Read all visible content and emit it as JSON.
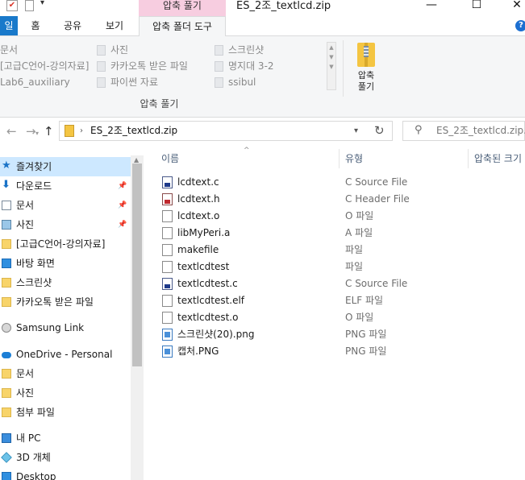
{
  "titlebar": {
    "context_header": "압축 풀기",
    "title": "ES_2조_textlcd.zip",
    "min_glyph": "—",
    "max_glyph": "☐",
    "close_glyph": "✕"
  },
  "tabs": [
    {
      "label": "일"
    },
    {
      "label": "홈"
    },
    {
      "label": "공유"
    },
    {
      "label": "보기"
    },
    {
      "label": "압축 폴더 도구"
    }
  ],
  "help": "?",
  "ribbon": {
    "destinations": [
      [
        "문서",
        "사진",
        "스크린샷"
      ],
      [
        "[고급C언어-강의자료]",
        "카카오톡 받은 파일",
        "명지대 3-2"
      ],
      [
        "Lab6_auxiliary",
        "파이썬 자료",
        "ssibul"
      ]
    ],
    "extract_all_label_1": "압축",
    "extract_all_label_2": "풀기",
    "group_label": "압축 풀기"
  },
  "address": {
    "path": "ES_2조_textlcd.zip",
    "search_placeholder": "ES_2조_textlcd.zip..."
  },
  "sidebar": {
    "items": [
      {
        "label": "즐겨찾기",
        "icon": "star-icon",
        "pinned": false,
        "selected": true
      },
      {
        "label": "다운로드",
        "icon": "download-icon",
        "pinned": true
      },
      {
        "label": "문서",
        "icon": "document-icon",
        "pinned": true
      },
      {
        "label": "사진",
        "icon": "picture-icon",
        "pinned": true
      },
      {
        "label": "[고급C언어-강의자료]",
        "icon": "folder-icon",
        "pinned": false
      },
      {
        "label": "바탕 화면",
        "icon": "desktop-icon",
        "pinned": false
      },
      {
        "label": "스크린샷",
        "icon": "folder-icon",
        "pinned": false
      },
      {
        "label": "카카오톡 받은 파일",
        "icon": "folder-icon",
        "pinned": false
      },
      {
        "label": "Samsung Link",
        "icon": "disk-icon",
        "pinned": false
      },
      {
        "label": "OneDrive - Personal",
        "icon": "cloud-icon",
        "pinned": false
      },
      {
        "label": "문서",
        "icon": "folder-icon",
        "pinned": false
      },
      {
        "label": "사진",
        "icon": "folder-icon",
        "pinned": false
      },
      {
        "label": "첨부 파일",
        "icon": "folder-icon",
        "pinned": false
      },
      {
        "label": "내 PC",
        "icon": "pc-icon",
        "pinned": false
      },
      {
        "label": "3D 개체",
        "icon": "3d-object-icon",
        "pinned": false
      },
      {
        "label": "Desktop",
        "icon": "desktop-icon",
        "pinned": false
      }
    ]
  },
  "columns": {
    "name": "이름",
    "type": "유형",
    "compressed": "압축된 크기"
  },
  "files": [
    {
      "name": "lcdtext.c",
      "type": "C Source File",
      "kind": "c"
    },
    {
      "name": "lcdtext.h",
      "type": "C Header File",
      "kind": "h"
    },
    {
      "name": "lcdtext.o",
      "type": "O 파일",
      "kind": "generic"
    },
    {
      "name": "libMyPeri.a",
      "type": "A 파일",
      "kind": "generic"
    },
    {
      "name": "makefile",
      "type": "파일",
      "kind": "generic"
    },
    {
      "name": "textlcdtest",
      "type": "파일",
      "kind": "generic"
    },
    {
      "name": "textlcdtest.c",
      "type": "C Source File",
      "kind": "c"
    },
    {
      "name": "textlcdtest.elf",
      "type": "ELF 파일",
      "kind": "generic"
    },
    {
      "name": "textlcdtest.o",
      "type": "O 파일",
      "kind": "generic"
    },
    {
      "name": "스크린샷(20).png",
      "type": "PNG 파일",
      "kind": "png"
    },
    {
      "name": "캡처.PNG",
      "type": "PNG 파일",
      "kind": "png"
    }
  ]
}
